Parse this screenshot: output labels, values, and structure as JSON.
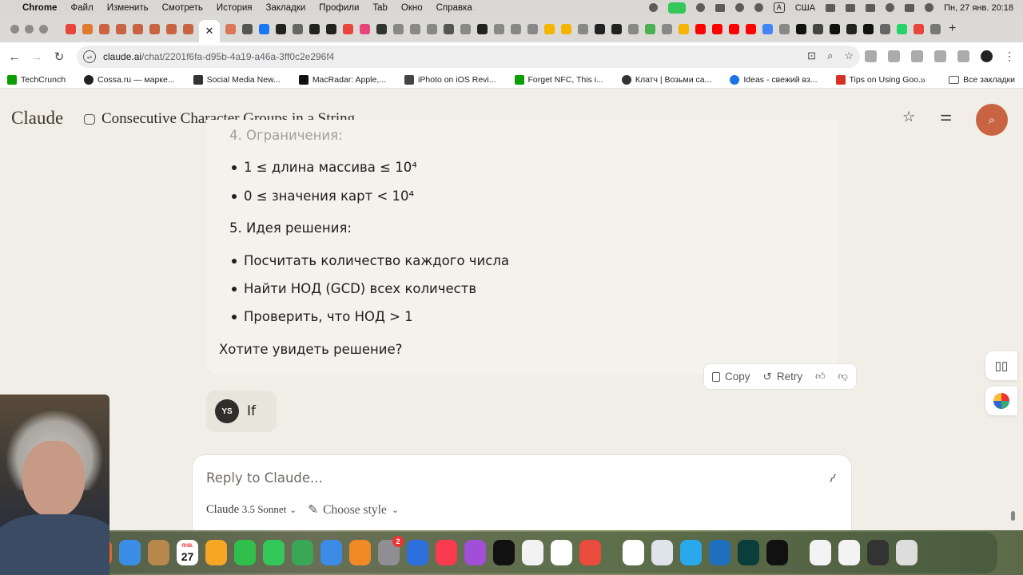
{
  "menubar": {
    "app": "Chrome",
    "items": [
      "Файл",
      "Изменить",
      "Смотреть",
      "История",
      "Закладки",
      "Профили",
      "Tab",
      "Окно",
      "Справка"
    ],
    "input_source": "А",
    "locale": "США",
    "datetime": "Пн, 27 янв. 20:18"
  },
  "browser": {
    "active_tab_icon": "claude-asterisk-icon",
    "close_tab": "✕",
    "new_tab": "+",
    "url_host": "claude.ai",
    "url_path": "/chat/2201f6fa-d95b-4a19-a46a-3ff0c2e296f4"
  },
  "bookmarks": {
    "items": [
      {
        "label": "TechCrunch",
        "color": "#0a9e01"
      },
      {
        "label": "Cossa.ru — марке...",
        "color": "#222222"
      },
      {
        "label": "Social Media New...",
        "color": "#333333"
      },
      {
        "label": "MacRadar: Apple,...",
        "color": "#111111"
      },
      {
        "label": "iPhoto on iOS Revi...",
        "color": "#444444"
      },
      {
        "label": "Forget NFC, This i...",
        "color": "#0a9e01"
      },
      {
        "label": "Клатч | Возьми са...",
        "color": "#333333"
      },
      {
        "label": "Ideas - свежий вз...",
        "color": "#1a73e8"
      },
      {
        "label": "Tips on Using Goo...",
        "color": "#d93025"
      }
    ],
    "all_bookmarks": "Все закладки"
  },
  "claude": {
    "logo": "Claude",
    "chat_title": "Consecutive Character Groups in a String"
  },
  "message": {
    "heading_faded": "4. Ограничения:",
    "constraint_1": "1 ≤ длина массива ≤ 10⁴",
    "constraint_2": "0 ≤ значения карт < 10⁴",
    "heading_idea": "5. Идея решения:",
    "idea_1": "Посчитать количество каждого числа",
    "idea_2": "Найти НОД (GCD) всех количеств",
    "idea_3": "Проверить, что НОД > 1",
    "question": "Хотите увидеть решение?"
  },
  "actions": {
    "copy": "Copy",
    "retry": "Retry"
  },
  "user_message": {
    "initials": "YS",
    "text": "If"
  },
  "composer": {
    "placeholder": "Reply to Claude...",
    "model": "Claude",
    "model_version": "3.5 Sonnet",
    "style": "Choose style"
  },
  "dock": {
    "calendar_month": "ЯНВ.",
    "calendar_day": "27",
    "badge": "2"
  },
  "colors": {
    "accent": "#c96442",
    "page_bg": "#f0eee6",
    "card_bg": "#f4f2ec"
  }
}
